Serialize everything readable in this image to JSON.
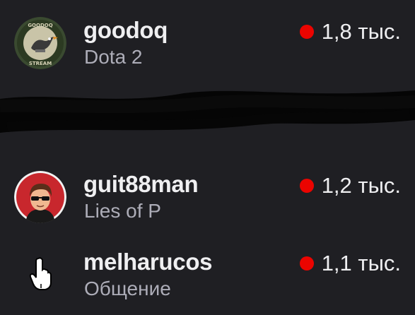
{
  "channels": [
    {
      "name": "goodoq",
      "category": "Dota 2",
      "viewers": "1,8 тыс.",
      "avatar_icon": "goose-stream-logo",
      "avatar_text_top": "GOODOQ",
      "avatar_text_bottom": "STREAM"
    },
    {
      "name": "guit88man",
      "category": "Lies of P",
      "viewers": "1,2 тыс.",
      "avatar_icon": "cartoon-man-sunglasses"
    },
    {
      "name": "melharucos",
      "category": "Общение",
      "viewers": "1,1 тыс.",
      "avatar_icon": "mouse-cursor-icon"
    }
  ],
  "colors": {
    "background": "#1f1f23",
    "name_text": "#efeff1",
    "category_text": "#adadb8",
    "live_dot": "#eb0400",
    "redaction": "#050505"
  }
}
